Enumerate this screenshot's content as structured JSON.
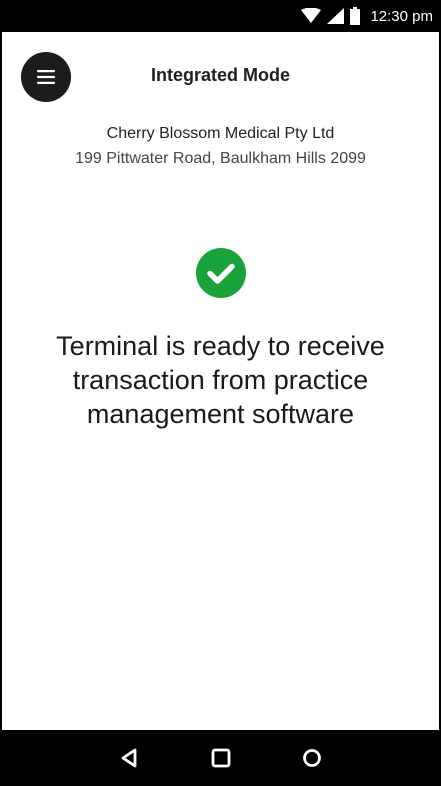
{
  "status_bar": {
    "time": "12:30 pm",
    "icons": [
      "wifi-icon",
      "signal-icon",
      "battery-icon"
    ]
  },
  "header": {
    "title": "Integrated Mode",
    "menu_icon": "hamburger-menu-icon"
  },
  "merchant": {
    "name": "Cherry Blossom Medical Pty Ltd",
    "address": "199 Pittwater Road, Baulkham Hills 2099"
  },
  "status": {
    "icon": "check-circle-icon",
    "message": "Terminal is ready to receive transaction from practice management software"
  },
  "navigation": {
    "buttons": [
      "back-icon",
      "home-icon",
      "recents-icon"
    ]
  },
  "colors": {
    "success": "#19a33a",
    "menu_button": "#1c1c1c",
    "system_bar": "#000000",
    "background": "#ffffff"
  }
}
